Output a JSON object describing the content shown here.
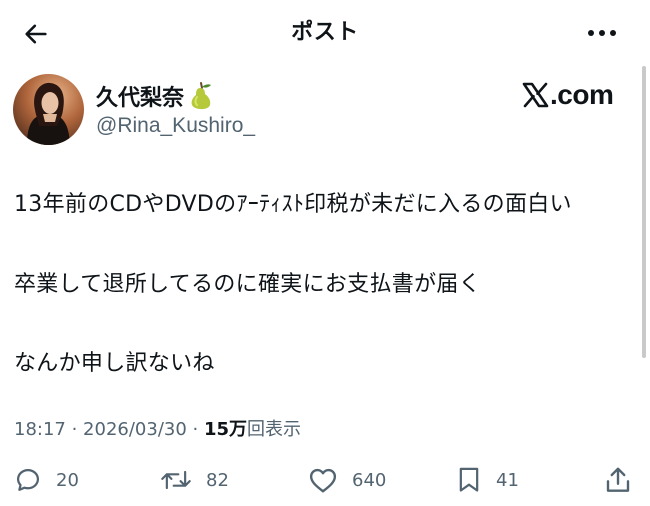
{
  "header": {
    "title": "ポスト",
    "back_icon": "arrow-left-icon",
    "more_icon": "more-horizontal-icon"
  },
  "author": {
    "display_name": "久代梨奈",
    "name_emoji": "pear-emoji",
    "handle": "@Rina_Kushiro_"
  },
  "watermark": {
    "text": ".com",
    "logo": "x-logo"
  },
  "tweet": {
    "lines": [
      "13年前のCDやDVDのｱｰﾃｨｽﾄ印税が未だに入るの面白い",
      "卒業して退所してるのに確実にお支払書が届く",
      "なんか申し訳ないね"
    ]
  },
  "meta": {
    "time": "18:17",
    "separator": " · ",
    "date": "2026/03/30",
    "views_count": "15万",
    "views_label": "回表示"
  },
  "actions": {
    "reply_count": "20",
    "retweet_count": "82",
    "like_count": "640",
    "bookmark_count": "41"
  },
  "colors": {
    "text": "#0f1419",
    "secondary": "#536471",
    "background": "#ffffff"
  }
}
